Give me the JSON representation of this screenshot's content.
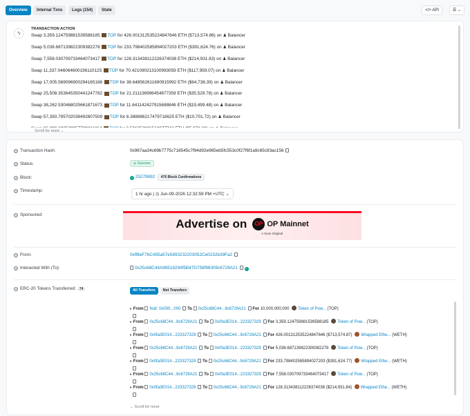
{
  "tabs": [
    {
      "label": "Overview"
    },
    {
      "label": "Internal Txns"
    },
    {
      "label": "Logs (154)"
    },
    {
      "label": "State"
    }
  ],
  "toolbar": {
    "api_label": "</> API",
    "menu_icon": "list-icon"
  },
  "transaction_action": {
    "title": "TRANSACTION ACTION",
    "rows": [
      {
        "verb": "Swap",
        "amount": "3,359.124759881539588185",
        "token": "TOP",
        "for": "for",
        "out": "426.001312535224847646 ETH",
        "usd": "($713,574.86)",
        "on": "on",
        "dex": "Balancer"
      },
      {
        "verb": "Swap",
        "amount": "5,038.687139822309382278",
        "token": "TOP",
        "for": "for",
        "out": "233.798402585894027203 ETH",
        "usd": "($391,624.76)",
        "on": "on",
        "dex": "Balancer"
      },
      {
        "verb": "Swap",
        "amount": "7,558.030709733464073417",
        "token": "TOP",
        "for": "for",
        "out": "128.313438112226374038 ETH",
        "usd": "($214,931.83)",
        "on": "on",
        "dex": "Balancer"
      },
      {
        "verb": "Swap",
        "amount": "11,337.046064600196110125",
        "token": "TOP",
        "for": "for",
        "out": "70.421090213100993059 ETH",
        "usd": "($117,959.07)",
        "on": "on",
        "dex": "Balancer"
      },
      {
        "verb": "Swap",
        "amount": "17,005.569096900294165188",
        "token": "TOP",
        "for": "for",
        "out": "38.648562611690915992 ETH",
        "usd": "($64,738.39)",
        "on": "on",
        "dex": "Balancer"
      },
      {
        "verb": "Swap",
        "amount": "25,508.353645350441247782",
        "token": "TOP",
        "for": "for",
        "out": "21.211136996454877359 ETH",
        "usd": "($35,529.78)",
        "on": "on",
        "dex": "Balancer"
      },
      {
        "verb": "Swap",
        "amount": "38,262.530468025661871673",
        "token": "TOP",
        "for": "for",
        "out": "11.641142427915688846 ETH",
        "usd": "($19,499.48)",
        "on": "on",
        "dex": "Balancer"
      },
      {
        "verb": "Swap",
        "amount": "57,393.795702038492807509",
        "token": "TOP",
        "for": "for",
        "out": "6.388886217479718625 ETH",
        "usd": "($10,701.72)",
        "on": "on",
        "dex": "Balancer"
      },
      {
        "verb": "Swap",
        "amount": "86,090.693539957739211364",
        "token": "TOP",
        "for": "for",
        "out": "3.506353906518077742 ETH",
        "usd": "($5,873.32)",
        "on": "on",
        "dex": "Balancer"
      }
    ],
    "scroll_hint": "Scroll for more"
  },
  "details": {
    "tx_hash_label": "Transaction Hash:",
    "tx_hash": "0x967aa34c69b7775c718545c7f94d92e965eb5fc553c0f27f6f1a9c65c93ac156",
    "status_label": "Status:",
    "status": "Success",
    "block_label": "Block:",
    "block": "25279892",
    "confirmations": "476 Block Confirmations",
    "timestamp_label": "Timestamp:",
    "timestamp_ago": "1 hr ago",
    "timestamp_sep": "|",
    "timestamp": "Jun-09-2026 12:32:59 PM +UTC",
    "sponsored_label": "Sponsored:",
    "ad_text": "Advertise on",
    "ad_brand": "OP Mainnet",
    "ad_logo": "OP",
    "ad_sub": "A Scan Original",
    "from_label": "From:",
    "from": "0xff8eF7bC455a57e5893232203052Ce0232b39Fa2",
    "to_label": "Interacted With (To):",
    "to": "0x25c68C44A96518294f5B47D758f98309c6729A21",
    "erc20_label": "ERC-20 Tokens Transferred:",
    "erc20_count": "74",
    "filter_all": "All Transfers",
    "filter_net": "Net Transfers",
    "scroll_hint": "Scroll for more"
  },
  "transfers": [
    {
      "from": "Null: 0x000...000",
      "to": "0x25c68C44...9c6729A21",
      "amount": "10,000,000,000",
      "token": "Token of Pow...",
      "sym": "(TOP)",
      "usd": "",
      "icon": "top"
    },
    {
      "from": "0x25c68C44...9c6729A21",
      "to": "0x0fa3E014...223327329",
      "amount": "3,359.124759881539588185",
      "token": "Token of Pow...",
      "sym": "(TOP)",
      "usd": "",
      "icon": "top"
    },
    {
      "from": "0x0fa3E014...223327329",
      "to": "0x25c68C44...9c6729A21",
      "amount": "426.001312535224847646",
      "token": "Wrapped Ethe...",
      "sym": "(WETH)",
      "usd": "($713,574.87)",
      "icon": "weth"
    },
    {
      "from": "0x25c68C44...9c6729A21",
      "to": "0x0fa3E014...223327329",
      "amount": "5,038.687139822309382278",
      "token": "Token of Pow...",
      "sym": "(TOP)",
      "usd": "",
      "icon": "top"
    },
    {
      "from": "0x0fa3E014...223327329",
      "to": "0x25c68C44...9c6729A21",
      "amount": "233.798402585894027203",
      "token": "Wrapped Ethe...",
      "sym": "(WETH)",
      "usd": "($391,624.77)",
      "icon": "weth"
    },
    {
      "from": "0x25c68C44...9c6729A21",
      "to": "0x0fa3E014...223327329",
      "amount": "7,558.030709733464073417",
      "token": "Token of Pow...",
      "sym": "(TOP)",
      "usd": "",
      "icon": "top"
    },
    {
      "from": "0x0fa3E014...223327329",
      "to": "0x25c68C44...9c6729A21",
      "amount": "128.313438112226374038",
      "token": "Wrapped Ethe...",
      "sym": "(WETH)",
      "usd": "($214,931.84)",
      "icon": "weth"
    }
  ],
  "transfer_words": {
    "from": "From",
    "to": "To",
    "for": "For"
  }
}
